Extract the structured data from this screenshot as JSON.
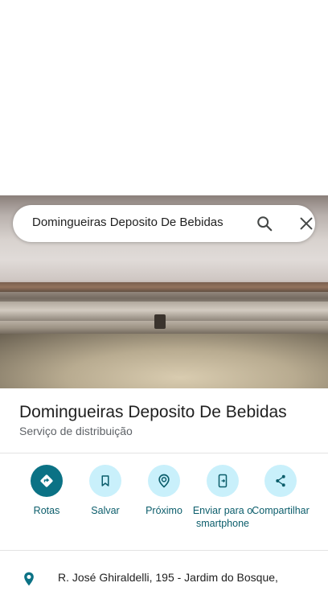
{
  "search": {
    "query": "Domingueiras Deposito De Bebidas",
    "search_icon": "search-icon",
    "close_icon": "close-icon"
  },
  "place": {
    "name": "Domingueiras Deposito De Bebidas",
    "category": "Serviço de distribuição",
    "address": "R. José Ghiraldelli, 195 - Jardim do Bosque,"
  },
  "actions": [
    {
      "label": "Rotas",
      "icon": "directions-icon"
    },
    {
      "label": "Salvar",
      "icon": "bookmark-icon"
    },
    {
      "label": "Próximo",
      "icon": "nearby-icon"
    },
    {
      "label": "Enviar para o smartphone",
      "icon": "send-to-phone-icon"
    },
    {
      "label": "Compartilhar",
      "icon": "share-icon"
    }
  ],
  "colors": {
    "accent": "#0b7285",
    "accent_light": "#c9f0fb",
    "action_text": "#0b5d6b"
  }
}
